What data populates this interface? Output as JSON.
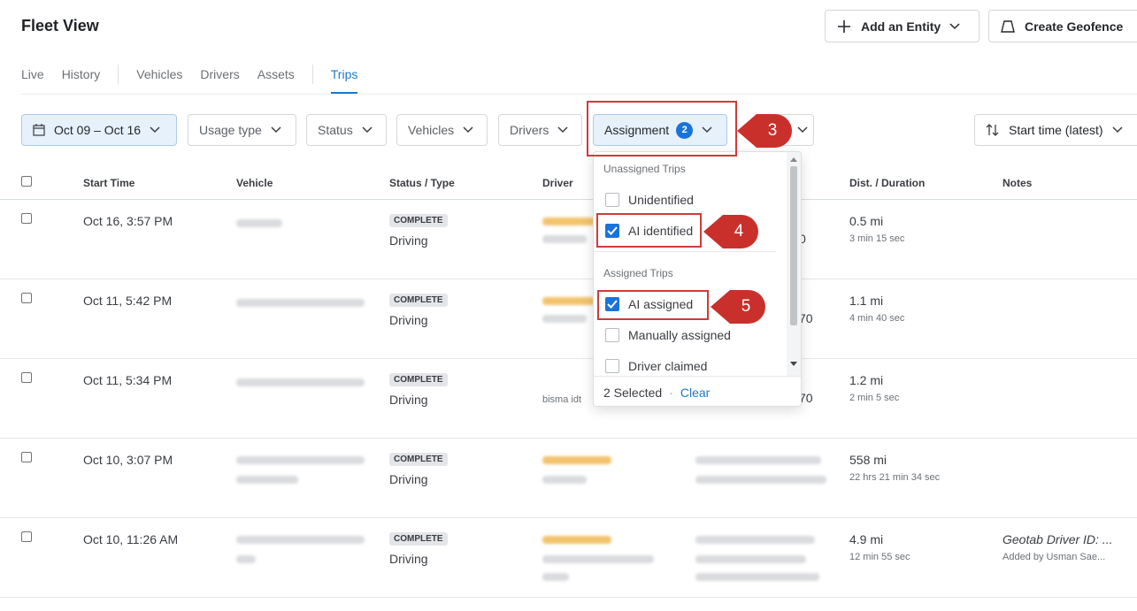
{
  "header": {
    "title": "Fleet View",
    "add_entity_label": "Add an Entity",
    "create_geofence_label": "Create Geofence"
  },
  "tabs": [
    "Live",
    "History",
    "Vehicles",
    "Drivers",
    "Assets",
    "Trips"
  ],
  "active_tab": "Trips",
  "filters": {
    "date": "Oct 09 – Oct 16",
    "usage_type": "Usage type",
    "status": "Status",
    "vehicles": "Vehicles",
    "drivers": "Drivers",
    "assignment": "Assignment",
    "assignment_count": "2",
    "sort": "Start time (latest)"
  },
  "columns": {
    "start_time": "Start Time",
    "vehicle": "Vehicle",
    "status_type": "Status / Type",
    "driver": "Driver",
    "dist_duration": "Dist. / Duration",
    "notes": "Notes"
  },
  "rows": [
    {
      "start": "Oct 16, 3:57 PM",
      "status": "COMPLETE",
      "type": "Driving",
      "addr_tail": "0",
      "dist": "0.5 mi",
      "duration": "3 min 15 sec",
      "note": "",
      "note_sub": "",
      "driver_text": ""
    },
    {
      "start": "Oct 11, 5:42 PM",
      "status": "COMPLETE",
      "type": "Driving",
      "addr_tail": "70",
      "dist": "1.1 mi",
      "duration": "4 min 40 sec",
      "note": "",
      "note_sub": "",
      "driver_text": ""
    },
    {
      "start": "Oct 11, 5:34 PM",
      "status": "COMPLETE",
      "type": "Driving",
      "addr_tail": "70",
      "dist": "1.2 mi",
      "duration": "2 min 5 sec",
      "note": "",
      "note_sub": "",
      "driver_text": "bisma idt"
    },
    {
      "start": "Oct 10, 3:07 PM",
      "status": "COMPLETE",
      "type": "Driving",
      "addr_tail": "",
      "dist": "558 mi",
      "duration": "22 hrs 21 min 34 sec",
      "note": "",
      "note_sub": "",
      "driver_text": ""
    },
    {
      "start": "Oct 10, 11:26 AM",
      "status": "COMPLETE",
      "type": "Driving",
      "addr_tail": "",
      "dist": "4.9 mi",
      "duration": "12 min 55 sec",
      "note": "Geotab Driver ID: ...",
      "note_sub": "Added by Usman Sae...",
      "driver_text": ""
    }
  ],
  "dropdown": {
    "section_unassigned": "Unassigned Trips",
    "section_assigned": "Assigned Trips",
    "items": [
      {
        "label": "Unidentified",
        "checked": false
      },
      {
        "label": "AI identified",
        "checked": true
      },
      {
        "label": "AI assigned",
        "checked": true
      },
      {
        "label": "Manually assigned",
        "checked": false
      },
      {
        "label": "Driver claimed",
        "checked": false
      }
    ],
    "selected_text": "2 Selected",
    "clear_label": "Clear"
  },
  "callouts": [
    "3",
    "4",
    "5"
  ],
  "colors": {
    "accent": "#1a73d9",
    "callout": "#c9302c"
  }
}
